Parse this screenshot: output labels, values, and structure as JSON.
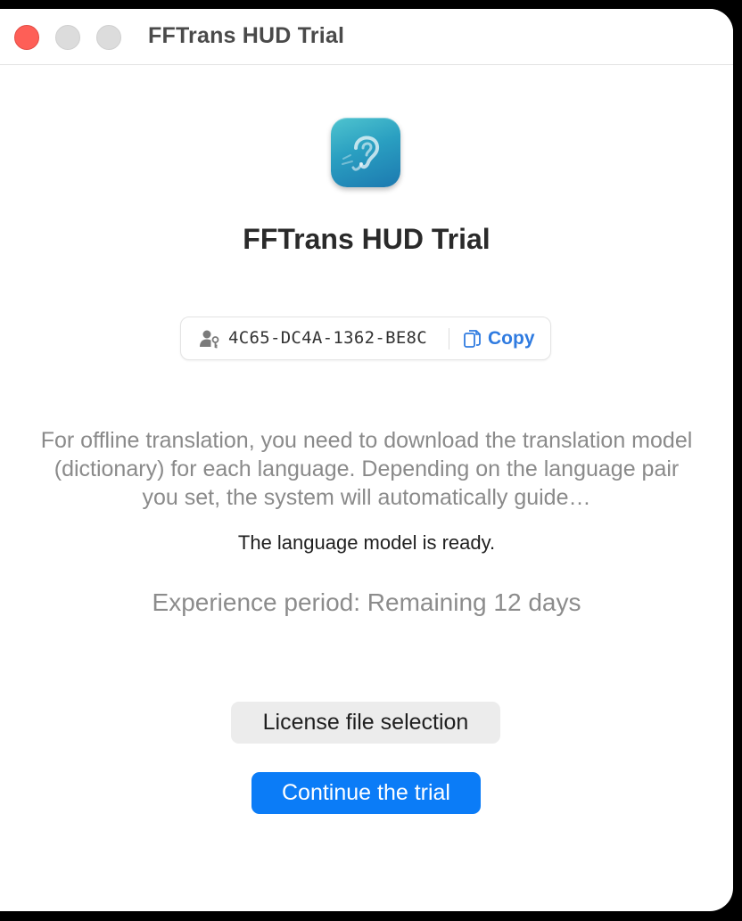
{
  "window": {
    "title": "FFTrans HUD Trial"
  },
  "app": {
    "title": "FFTrans HUD Trial",
    "icon": "ear-icon"
  },
  "license_key": {
    "value": "4C65-DC4A-1362-BE8C",
    "icon": "person-key-icon",
    "copy_label": "Copy",
    "copy_icon": "copy-icon"
  },
  "description": "For offline translation, you need to download the translation model (dictionary) for each language. Depending on the language pair you set, the system will automatically guide…",
  "status": "The language model is ready.",
  "experience": "Experience period: Remaining 12 days",
  "buttons": {
    "license_file": "License file selection",
    "continue_trial": "Continue the trial"
  },
  "colors": {
    "accent": "#0b7cf7",
    "link": "#2f7be0",
    "close": "#fe5f57"
  }
}
